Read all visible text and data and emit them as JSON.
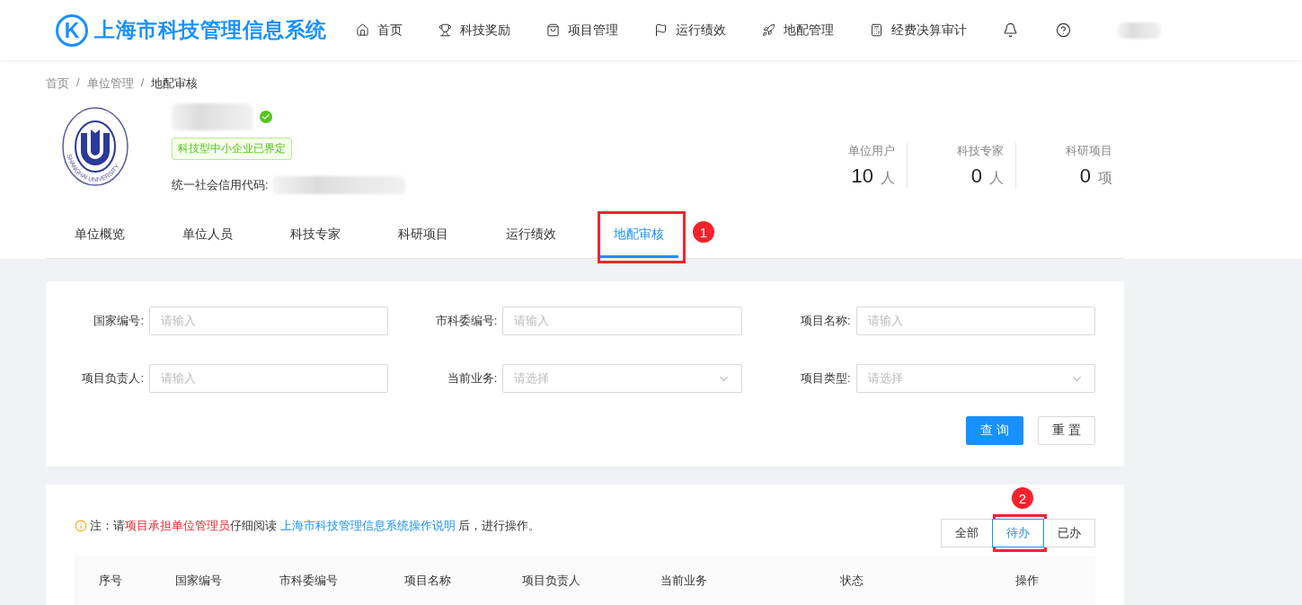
{
  "header": {
    "logo_letter": "K",
    "title": "上海市科技管理信息系统",
    "nav": [
      {
        "label": "首页"
      },
      {
        "label": "科技奖励"
      },
      {
        "label": "项目管理"
      },
      {
        "label": "运行绩效"
      },
      {
        "label": "地配管理"
      },
      {
        "label": "经费决算审计"
      }
    ]
  },
  "breadcrumb": {
    "separator": "/",
    "items": [
      "首页",
      "单位管理",
      "地配审核"
    ]
  },
  "unit": {
    "verified": true,
    "seal_text": "SHANGHAI UNIVERSITY",
    "tag": "科技型中小企业已界定",
    "credit_code_label": "统一社会信用代码:"
  },
  "stats": [
    {
      "label": "单位用户",
      "value": "10",
      "unit": "人"
    },
    {
      "label": "科技专家",
      "value": "0",
      "unit": "人"
    },
    {
      "label": "科研项目",
      "value": "0",
      "unit": "项"
    }
  ],
  "tabs": [
    {
      "label": "单位概览",
      "selected": false
    },
    {
      "label": "单位人员",
      "selected": false
    },
    {
      "label": "科技专家",
      "selected": false
    },
    {
      "label": "科研项目",
      "selected": false
    },
    {
      "label": "运行绩效",
      "selected": false
    },
    {
      "label": "地配审核",
      "selected": true,
      "callout": "1"
    }
  ],
  "filters": [
    {
      "label": "国家编号:",
      "kind": "input",
      "placeholder": "请输入"
    },
    {
      "label": "市科委编号:",
      "kind": "input",
      "placeholder": "请输入"
    },
    {
      "label": "项目名称:",
      "kind": "input",
      "placeholder": "请输入"
    },
    {
      "label": "项目负责人:",
      "kind": "input",
      "placeholder": "请输入"
    },
    {
      "label": "当前业务:",
      "kind": "select",
      "placeholder": "请选择"
    },
    {
      "label": "项目类型:",
      "kind": "select",
      "placeholder": "请选择"
    }
  ],
  "actions": [
    {
      "label": "查 询",
      "kind": "primary"
    },
    {
      "label": "重 置",
      "kind": "default"
    }
  ],
  "note": [
    {
      "kind": "plain",
      "text": "注：请"
    },
    {
      "kind": "highlight",
      "text": "项目承担单位管理员"
    },
    {
      "kind": "plain",
      "text": "仔细阅读 "
    },
    {
      "kind": "link",
      "text": "上海市科技管理信息系统操作说明"
    },
    {
      "kind": "plain",
      "text": " 后，进行操作。"
    }
  ],
  "status_filter": [
    {
      "label": "全部",
      "selected": false
    },
    {
      "label": "待办",
      "selected": true,
      "callout": "2"
    },
    {
      "label": "已办",
      "selected": false
    }
  ],
  "table": {
    "columns": [
      "序号",
      "国家编号",
      "市科委编号",
      "项目名称",
      "项目负责人",
      "当前业务",
      "状态",
      "操作"
    ]
  }
}
